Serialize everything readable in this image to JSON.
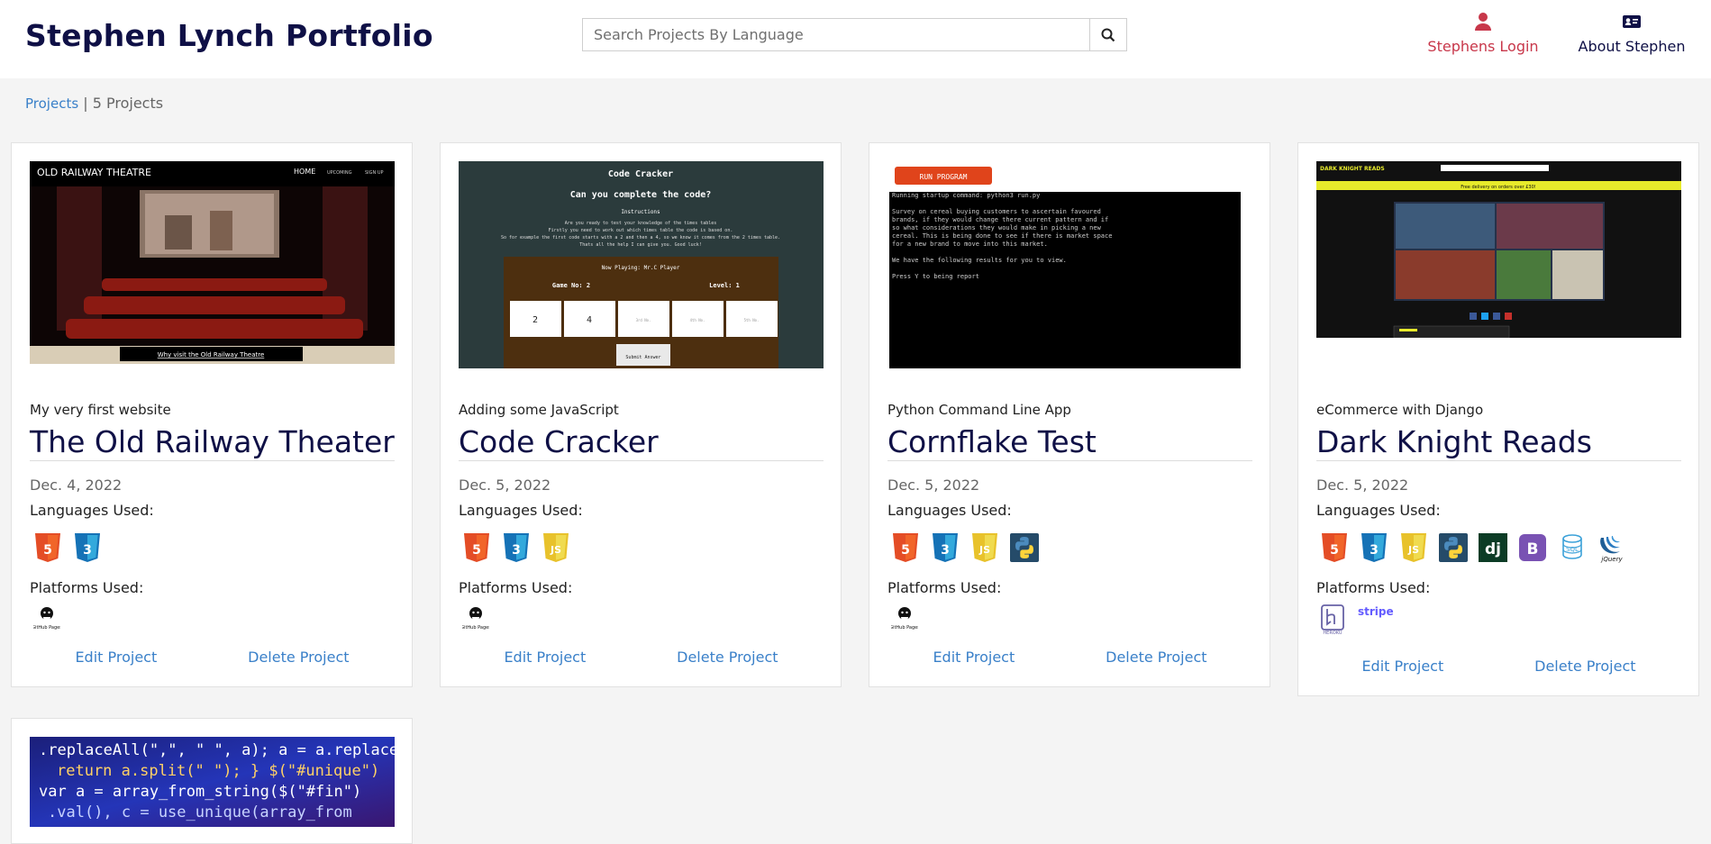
{
  "header": {
    "brand": "Stephen Lynch Portfolio",
    "search_placeholder": "Search Projects By Language",
    "login_label": "Stephens Login",
    "about_label": "About Stephen"
  },
  "breadcrumb": {
    "link": "Projects",
    "separator": "|",
    "count": "5 Projects"
  },
  "projects": [
    {
      "subtitle": "My very first website",
      "title": "The Old Railway Theater",
      "date": "Dec. 4, 2022",
      "languages_label": "Languages Used:",
      "platforms_label": "Platforms Used:",
      "languages": [
        "html5",
        "css3"
      ],
      "platforms": [
        "github-pages"
      ],
      "edit": "Edit Project",
      "delete": "Delete Project",
      "preview": {
        "site_name": "OLD RAILWAY THEATRE",
        "nav": [
          "HOME",
          "UPCOMING",
          "SIGN UP"
        ],
        "caption": "Why visit the Old Railway Theatre"
      }
    },
    {
      "subtitle": "Adding some JavaScript",
      "title": "Code Cracker",
      "date": "Dec. 5, 2022",
      "languages_label": "Languages Used:",
      "platforms_label": "Platforms Used:",
      "languages": [
        "html5",
        "css3",
        "javascript"
      ],
      "platforms": [
        "github-pages"
      ],
      "edit": "Edit Project",
      "delete": "Delete Project",
      "preview": {
        "heading": "Code Cracker",
        "question": "Can you complete the code?",
        "instructions_title": "Instructions",
        "instructions": [
          "Are you ready to test your knowledge of the times tables",
          "Firstly you need to work out which times table the code is based on.",
          "So for example the first code starts with a 2 and then a 4, so we know it comes from the 2 times table.",
          "Thats all the help I can give you. Good luck!"
        ],
        "now_playing": "Now Playing: Mr.C Player",
        "game_no": "Game No: 2",
        "level": "Level: 1",
        "boxes": [
          "2",
          "4",
          "3rd No.",
          "4th No.",
          "5th No."
        ],
        "submit": "Submit Answer"
      }
    },
    {
      "subtitle": "Python Command Line App",
      "title": "Cornflake Test",
      "date": "Dec. 5, 2022",
      "languages_label": "Languages Used:",
      "platforms_label": "Platforms Used:",
      "languages": [
        "html5",
        "css3",
        "javascript",
        "python"
      ],
      "platforms": [
        "github-pages"
      ],
      "edit": "Edit Project",
      "delete": "Delete Project",
      "preview": {
        "run_button": "RUN PROGRAM",
        "terminal": [
          "Running startup command: python3 run.py",
          "",
          "  Survey on cereal buying customers to ascertain favoured",
          "  brands, if they would change there current pattern and if",
          "  so what considerations they would make in picking a new",
          "  cereal. This is being done to see if there is market space",
          "  for a new brand to move into this market.",
          "",
          "  We have the following results for you to view.",
          "",
          "  Press Y to being report"
        ]
      }
    },
    {
      "subtitle": "eCommerce with Django",
      "title": "Dark Knight Reads",
      "date": "Dec. 5, 2022",
      "languages_label": "Languages Used:",
      "platforms_label": "Platforms Used:",
      "languages": [
        "html5",
        "css3",
        "javascript",
        "python",
        "django",
        "bootstrap",
        "sql",
        "jquery"
      ],
      "platforms": [
        "heroku",
        "stripe"
      ],
      "edit": "Edit Project",
      "delete": "Delete Project",
      "preview": {
        "logo": "DARK KNIGHT READS",
        "banner": "Free delivery on orders over £30!"
      }
    },
    {
      "preview": {
        "code_lines": [
          ".replaceAll(\",\", \" \", a); a = a.replace",
          "return a.split(\" \"); } $(\"#unique\")",
          "var a = array_from_string($(\"#fin\")",
          ".val(), c = use_unique(array_from"
        ]
      }
    }
  ],
  "icon_labels": {
    "html5": "5",
    "css3": "3",
    "javascript": "JS",
    "django": "dj",
    "bootstrap": "B",
    "jquery": "jQuery",
    "github_pages": "GitHub Pages",
    "heroku": "HEROKU",
    "stripe": "stripe"
  },
  "colors": {
    "brand": "#0f1046",
    "link": "#3a80c9",
    "login": "#c8374a",
    "html5": "#e44d26",
    "css3": "#1572b6",
    "js": "#f0db4f",
    "python": "#306998",
    "django": "#0c3c26",
    "bootstrap": "#7952b3"
  }
}
